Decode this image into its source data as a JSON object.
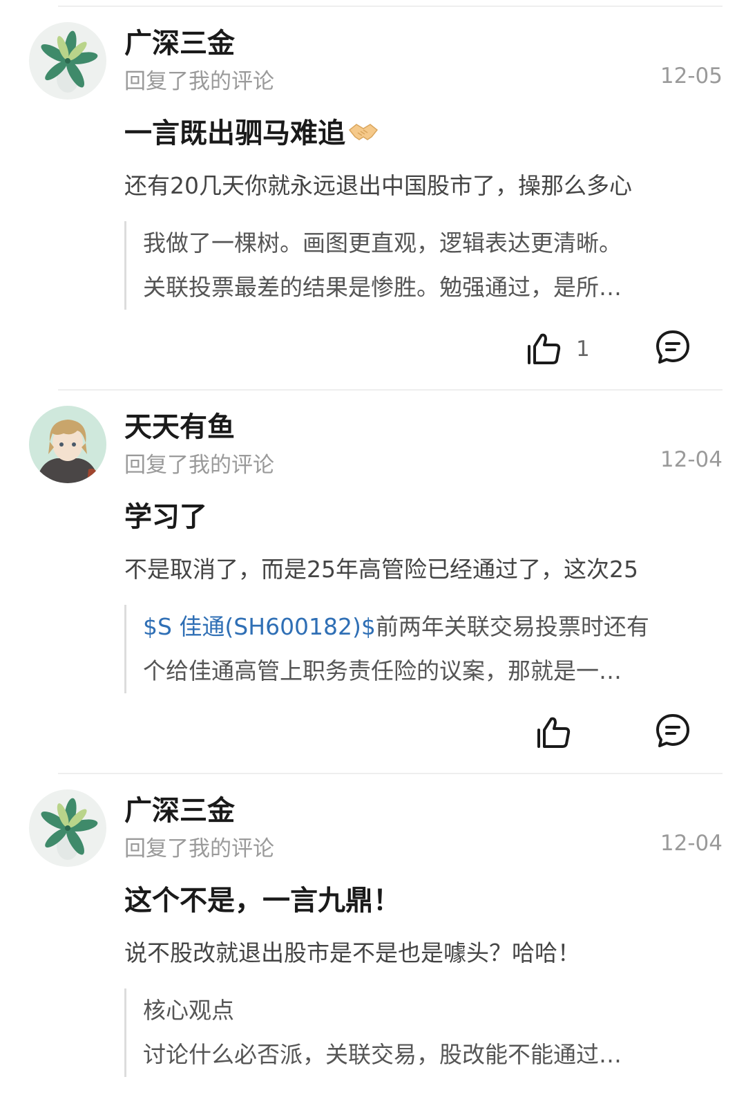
{
  "comments": [
    {
      "username": "广深三金",
      "action": "回复了我的评论",
      "date": "12-05",
      "reply": "一言既出驷马难追",
      "reply_emoji": "handshake-emoji",
      "original": "还有20几天你就永远退出中国股市了，操那么多心",
      "quote_lines": [
        "我做了一棵树。画图更直观，逻辑表达更清晰。",
        "关联投票最差的结果是惨胜。勉强通过，是所…"
      ],
      "like_count": "1"
    },
    {
      "username": "天天有鱼",
      "action": "回复了我的评论",
      "date": "12-04",
      "reply": "学习了",
      "original": "不是取消了，而是25年高管险已经通过了，这次25",
      "quote_stock": "$S 佳通(SH600182)$",
      "quote_line1_rest": "前两年关联交易投票时还有",
      "quote_line2": "个给佳通高管上职务责任险的议案，那就是一…",
      "like_count": ""
    },
    {
      "username": "广深三金",
      "action": "回复了我的评论",
      "date": "12-04",
      "reply": "这个不是，一言九鼎！",
      "original": "说不股改就退出股市是不是也是噱头？哈哈！",
      "quote_lines": [
        "核心观点",
        "讨论什么必否派，关联交易，股改能不能通过…"
      ]
    }
  ],
  "colors": {
    "link_blue": "#2f6fb5",
    "muted_gray": "#9a9a9a",
    "divider": "#eeeeee"
  },
  "icons": {
    "like": "thumbs-up-icon",
    "comment": "comment-bubble-icon"
  }
}
